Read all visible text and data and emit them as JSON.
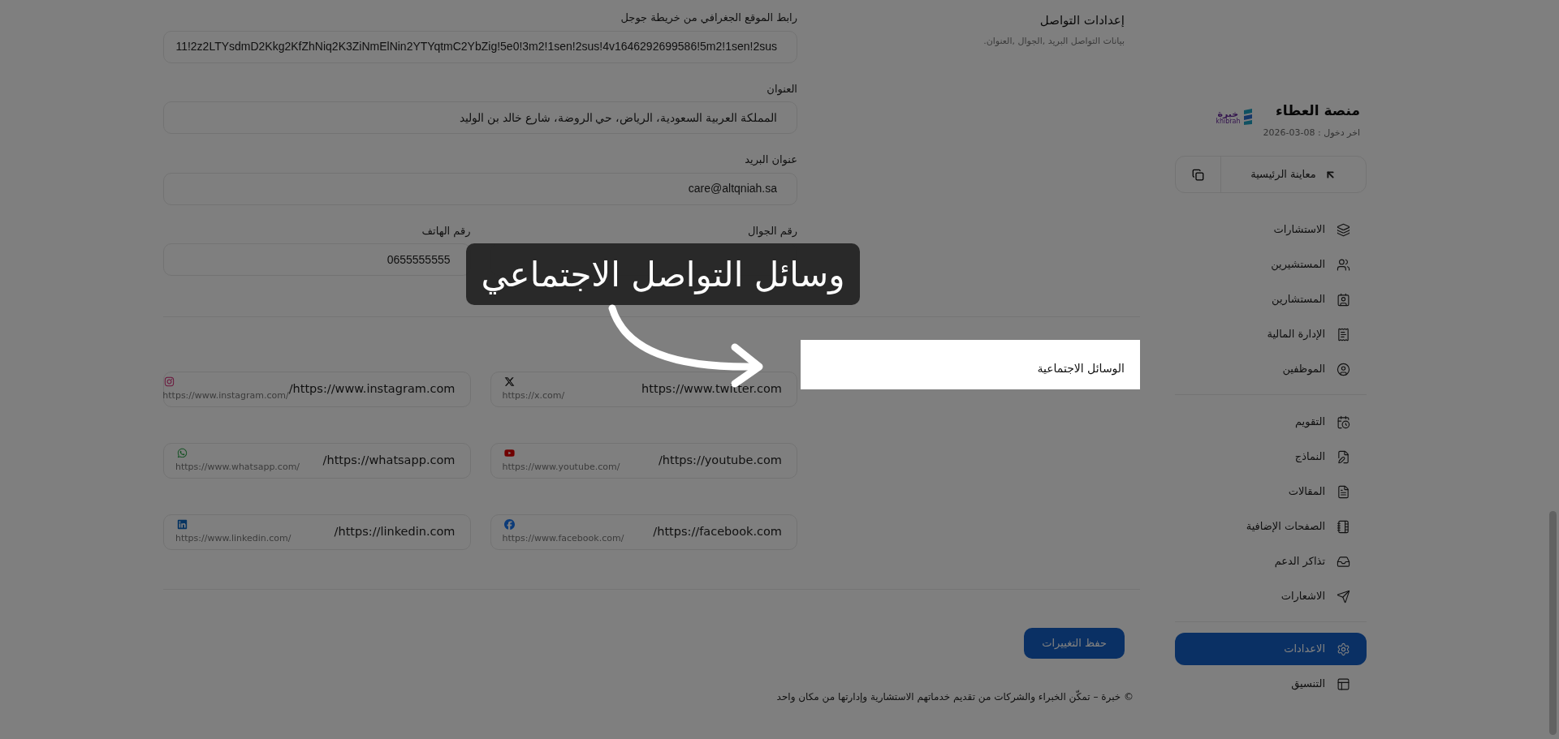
{
  "contact_settings": {
    "title": "إعدادات التواصل",
    "subtitle": "بيانات التواصل البريد ,الجوال ,العنوان."
  },
  "fields": [
    {
      "label": "رابط الموقع الجغرافي من خريطة جوجل",
      "value": "11!2z2LTYsdmD2Kkg2KfZhNiq2K3ZiNmElNin2YTYqtmC2YbZig!5e0!3m2!1sen!2sus!4v1646292699586!5m2!1sen!2sus"
    },
    {
      "label": "العنوان",
      "value": "المملكة العربية السعودية، الرياض، حي الروضة، شارع خالد بن الوليد"
    },
    {
      "label": "عنوان البريد",
      "value": "care@altqniah.sa"
    }
  ],
  "phones": [
    {
      "label": "رقم الجوال"
    },
    {
      "label": "رقم الهاتف",
      "value": "0655555555"
    }
  ],
  "social": {
    "title": "الوسائل الاجتماعية",
    "links": [
      {
        "kind": "x",
        "value": "https://www.twitter.com",
        "hint": "https://x.com/"
      },
      {
        "kind": "instagram",
        "value": "https://www.instagram.com/",
        "hint": "https://www.instagram.com/"
      },
      {
        "kind": "youtube",
        "value": "https://youtube.com/",
        "hint": "https://www.youtube.com/"
      },
      {
        "kind": "whatsapp",
        "value": "https://whatsapp.com/",
        "hint": "https://www.whatsapp.com/"
      },
      {
        "kind": "facebook",
        "value": "https://facebook.com/",
        "hint": "https://www.facebook.com/"
      },
      {
        "kind": "linkedin",
        "value": "https://linkedin.com/",
        "hint": "https://www.linkedin.com/"
      }
    ]
  },
  "save_button": "حفظ التغييرات",
  "footer": "© خبرة – تمكّن الخبراء والشركات من تقديم خدماتهم الاستشارية وإدارتها من مكان واحد",
  "sidebar": {
    "logo": {
      "text": "خبرة",
      "latin": "khibrah"
    },
    "name": "منصة العطاء",
    "last_login": "اخر دخول : 08-03-2026",
    "preview_button": "معاينة الرئيسية",
    "groups": [
      [
        {
          "label": "الاستشارات",
          "selected": false
        },
        {
          "label": "المستشيرين",
          "selected": false
        },
        {
          "label": "المستشارين",
          "selected": false
        },
        {
          "label": "الإدارة المالية",
          "selected": false
        },
        {
          "label": "الموظفين",
          "selected": false
        }
      ],
      [
        {
          "label": "التقويم",
          "selected": false
        },
        {
          "label": "النماذج",
          "selected": false
        },
        {
          "label": "المقالات",
          "selected": false
        },
        {
          "label": "الصفحات الإضافية",
          "selected": false
        },
        {
          "label": "تذاكر الدعم",
          "selected": false
        },
        {
          "label": "الاشعارات",
          "selected": false
        }
      ],
      [
        {
          "label": "الاعدادات",
          "selected": true
        },
        {
          "label": "التنسيق",
          "selected": false
        }
      ]
    ]
  },
  "tour": {
    "text": "وسائل التواصل الاجتماعي"
  }
}
